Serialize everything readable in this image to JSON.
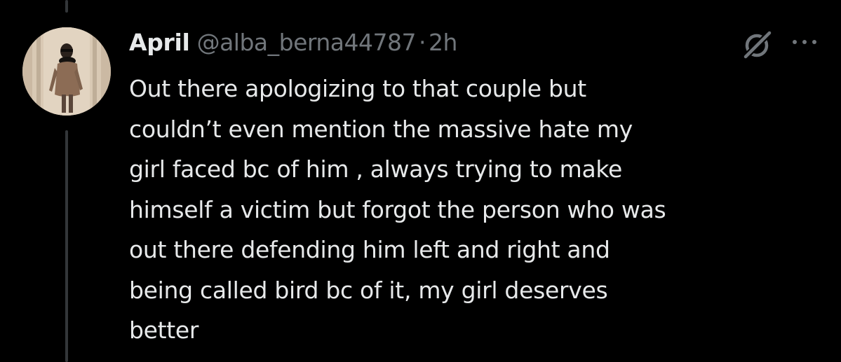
{
  "tweet": {
    "display_name": "April",
    "handle": "@alba_berna44787",
    "separator": "·",
    "timestamp": "2h",
    "text_lines": [
      "Out there apologizing to that couple but",
      "couldn’t even mention the massive hate my",
      "girl faced bc of him , always trying to make",
      "himself a victim but forgot the person who was",
      "out there defending him left and right and",
      "being called bird bc of it, my girl deserves",
      "better"
    ]
  },
  "icons": {
    "grok": "grok-icon",
    "more": "more-icon"
  },
  "colors": {
    "background": "#000000",
    "primary_text": "#e7e9ea",
    "secondary_text": "#71767b",
    "thread_line": "#333639"
  }
}
